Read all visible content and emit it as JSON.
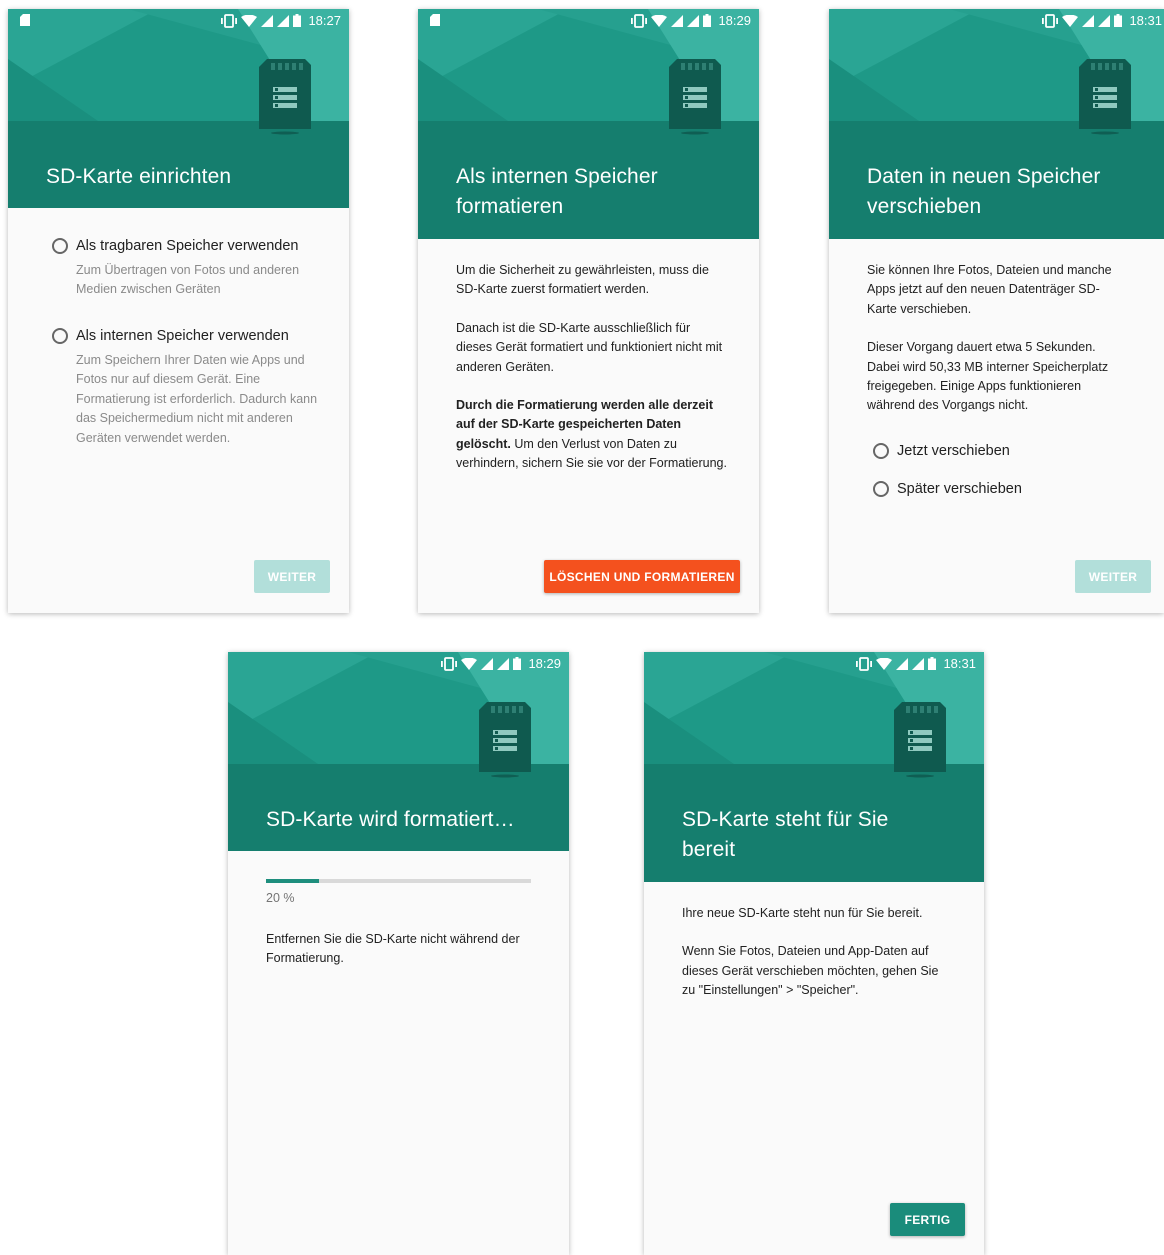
{
  "screens": [
    {
      "time": "18:27",
      "title": "SD-Karte einrichten",
      "options": [
        {
          "label": "Als tragbaren Speicher verwenden",
          "desc": "Zum Übertragen von Fotos und anderen Medien zwischen Geräten"
        },
        {
          "label": "Als internen Speicher verwenden",
          "desc": "Zum Speichern Ihrer Daten wie Apps und Fotos nur auf diesem Gerät. Eine Formatierung ist erforderlich. Dadurch kann das Speichermedium nicht mit anderen Geräten verwendet werden."
        }
      ],
      "button": "WEITER"
    },
    {
      "time": "18:29",
      "title": "Als internen Speicher formatieren",
      "paragraphs": [
        "Um die Sicherheit zu gewährleisten, muss die SD-Karte zuerst formatiert werden.",
        "Danach ist die SD-Karte ausschließlich für dieses Gerät formatiert und funktioniert nicht mit anderen Geräten."
      ],
      "warning_bold": "Durch die Formatierung werden alle derzeit auf der SD-Karte gespeicherten Daten gelöscht.",
      "warning_rest": " Um den Verlust von Daten zu verhindern, sichern Sie sie vor der Formatierung.",
      "button": "LÖSCHEN UND FORMATIEREN"
    },
    {
      "time": "18:31",
      "title": "Daten in neuen Speicher verschieben",
      "paragraphs": [
        "Sie können Ihre Fotos, Dateien und manche Apps jetzt auf den neuen Datenträger SD-Karte verschieben.",
        "Dieser Vorgang dauert etwa 5 Sekunden. Dabei wird 50,33 MB interner Speicherplatz freigegeben. Einige Apps funktionieren während des Vorgangs nicht."
      ],
      "options": [
        "Jetzt verschieben",
        "Später verschieben"
      ],
      "button": "WEITER"
    },
    {
      "time": "18:29",
      "title": "SD-Karte wird formatiert…",
      "progress": 0.2,
      "progress_text": "20 %",
      "paragraphs": [
        "Entfernen Sie die SD-Karte nicht während der Formatierung."
      ]
    },
    {
      "time": "18:31",
      "title": "SD-Karte steht für Sie bereit",
      "paragraphs": [
        "Ihre neue SD-Karte steht nun für Sie bereit.",
        "Wenn Sie Fotos, Dateien und App-Daten auf dieses Gerät verschieben möchten, gehen Sie zu \"Einstellungen\" > \"Speicher\"."
      ],
      "button": "FERTIG"
    }
  ],
  "colors": {
    "hero": "#1e9987",
    "header": "#157e6e",
    "button_disabled": "#b2dfda",
    "button_destructive": "#f4511e",
    "button_primary": "#1a8c7b"
  },
  "icons": [
    "sd-card-small-icon",
    "vibrate-icon",
    "wifi-icon",
    "signal-icon",
    "battery-icon",
    "sd-card-storage-icon",
    "radio-button-icon"
  ]
}
